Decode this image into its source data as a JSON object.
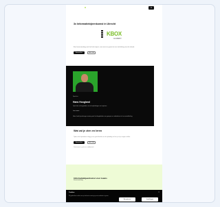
{
  "nav": {
    "menu_label": "≡"
  },
  "hero": {
    "title": "3x Informatiebijeenkomst in Utrecht",
    "brand_name": "KBOX",
    "brand_tag": "ACADEMY",
    "description": "Een kennismaking met het hele traject, van meet en greet tot een toelichting van de inhoud.",
    "primary_button": "Aanmelden",
    "secondary_button": "Meer info"
  },
  "speaker": {
    "label": "Spreker",
    "name": "Hans Hoogland",
    "bio": "Oprichter en begeleider van de opleidingen en trajecten.",
    "link": "Lees meer",
    "text": "Hans heeft jarenlange ervaring met het begeleiden van groepen en individuen in hun ontwikkeling."
  },
  "section2": {
    "title": "Wat zal je zien en leren",
    "description": "Tijdens de bijeenkomst krijg je een goed beeld van de opleiding en kun je al je vragen stellen.",
    "primary_button": "Aanmelden",
    "secondary_button": "Meer info",
    "fine_print": "Deelname is gratis en vrijblijvend."
  },
  "green_section": {
    "title": "Informatiebijeenkomst voor teams",
    "subtitle": "Kennismaking"
  },
  "cookie": {
    "title": "Cookies",
    "close": "×",
    "text": "Wij gebruiken cookies om je de beste ervaring op onze website te geven.",
    "accept_button": "Accepteren",
    "settings_button": "Instellingen"
  },
  "colors": {
    "accent_green": "#7cbf2a",
    "light_green": "#eefbd6",
    "dark": "#0a0a0a"
  }
}
